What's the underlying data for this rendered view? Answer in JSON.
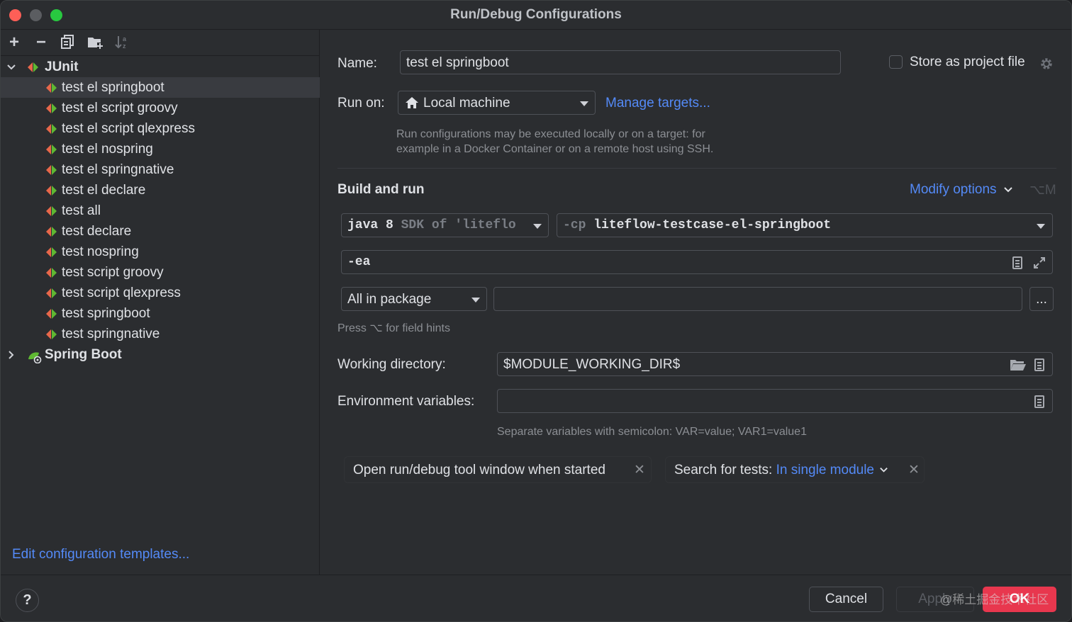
{
  "window": {
    "title": "Run/Debug Configurations"
  },
  "toolbar": {
    "add_icon": "plus-icon",
    "remove_icon": "minus-icon",
    "copy_icon": "copy-icon",
    "folder_icon": "new-folder-icon",
    "sort_icon": "sort-icon"
  },
  "tree": {
    "junit_label": "JUnit",
    "items": [
      "test el springboot",
      "test el script groovy",
      "test el script qlexpress",
      "test el nospring",
      "test el springnative",
      "test el declare",
      "test all",
      "test declare",
      "test nospring",
      "test script groovy",
      "test script qlexpress",
      "test springboot",
      "test springnative"
    ],
    "spring_boot_label": "Spring Boot"
  },
  "edit_templates_link": "Edit configuration templates...",
  "form": {
    "name_label": "Name:",
    "name_value": "test el springboot",
    "store_label": "Store as project file",
    "run_on_label": "Run on:",
    "run_on_value": "Local machine",
    "manage_targets": "Manage targets...",
    "run_on_hint_1": "Run configurations may be executed locally or on a target: for",
    "run_on_hint_2": "example in a Docker Container or on a remote host using SSH.",
    "build_run_label": "Build and run",
    "modify_options": "Modify options",
    "modify_shortcut": "⌥M",
    "sdk_java": "java 8",
    "sdk_rest": "SDK of 'liteflo",
    "cp_prefix": "-cp",
    "cp_value": "liteflow-testcase-el-springboot",
    "vm_options": "-ea",
    "test_kind": "All in package",
    "package_value": "",
    "browse_button": "...",
    "field_hints": "Press ⌥ for field hints",
    "workdir_label": "Working directory:",
    "workdir_value": "$MODULE_WORKING_DIR$",
    "env_label": "Environment variables:",
    "env_value": "",
    "env_hint": "Separate variables with semicolon: VAR=value; VAR1=value1",
    "chip_open_window": "Open run/debug tool window when started",
    "chip_search_label": "Search for tests:",
    "chip_search_value": "In single module"
  },
  "buttons": {
    "help": "?",
    "cancel": "Cancel",
    "apply": "Apply",
    "ok": "OK"
  },
  "watermark": "@稀土掘金技术社区",
  "colors": {
    "background": "#2b2d30",
    "link": "#548af7",
    "ok_button": "#e8374e",
    "junit_red": "#e8674a",
    "junit_green": "#5fb832"
  }
}
